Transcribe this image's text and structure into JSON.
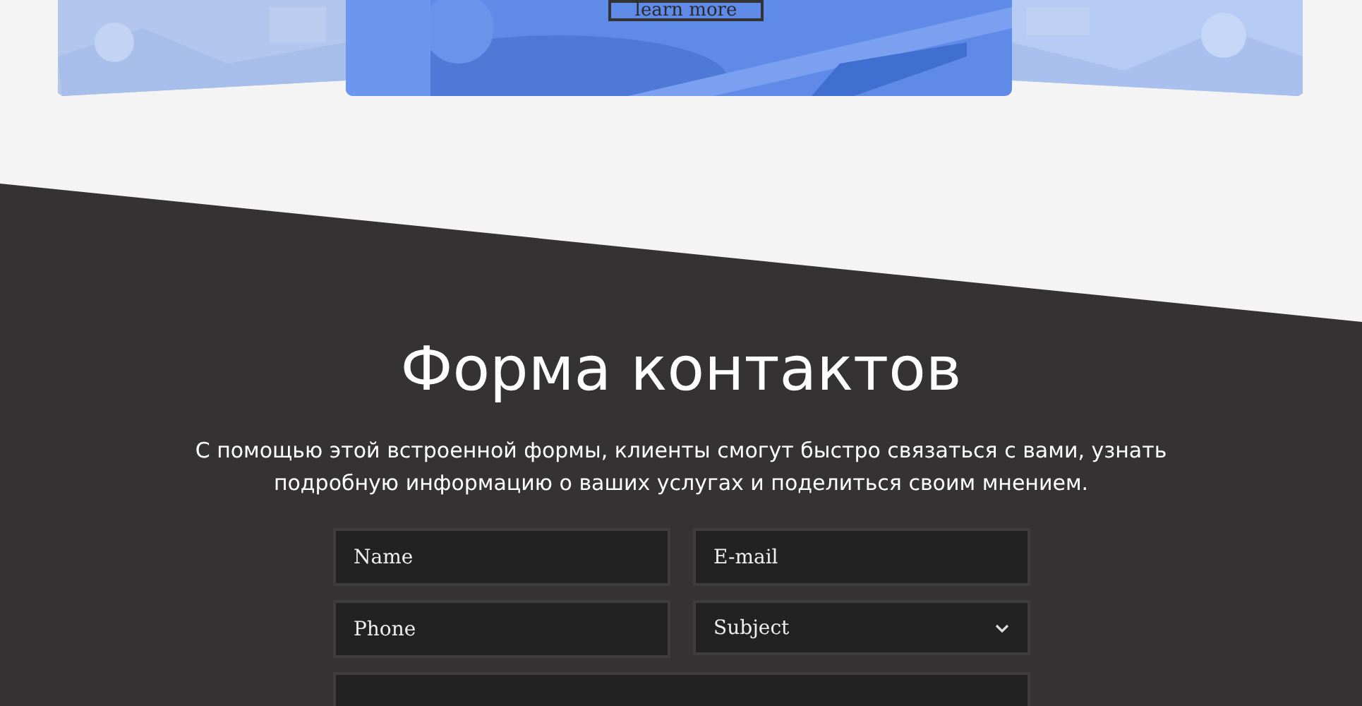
{
  "hero_cards": {
    "button": "learn more"
  },
  "contact": {
    "title": "Форма контактов",
    "description": "С помощью этой встроенной формы, клиенты смогут быстро связаться с вами, узнать подробную информацию о ваших услугах и поделиться своим мнением.",
    "fields": [
      {
        "kind": "input",
        "placeholder": "Name"
      },
      {
        "kind": "input",
        "placeholder": "E-mail"
      },
      {
        "kind": "input",
        "placeholder": "Phone"
      },
      {
        "kind": "select",
        "value": "Subject"
      }
    ]
  }
}
